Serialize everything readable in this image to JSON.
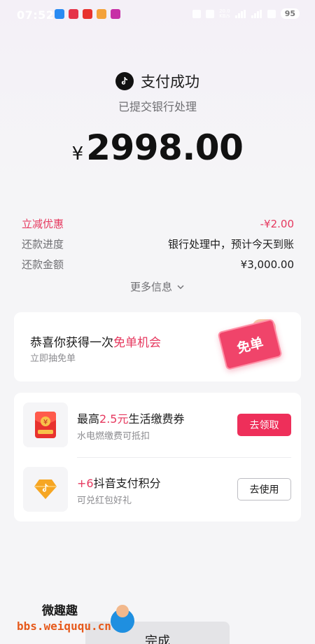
{
  "status_bar": {
    "time": "07:52",
    "net_speed_value": "20.0",
    "net_speed_unit": "KB/s",
    "battery": "95"
  },
  "header": {
    "title": "支付成功",
    "subtitle": "已提交银行处理",
    "currency_symbol": "¥",
    "amount": "2998.00"
  },
  "details": [
    {
      "label": "立减优惠",
      "value": "-¥2.00",
      "highlight": true
    },
    {
      "label": "还款进度",
      "value": "银行处理中，预计今天到账",
      "highlight": false
    },
    {
      "label": "还款金额",
      "value": "¥3,000.00",
      "highlight": false
    }
  ],
  "more_info_label": "更多信息",
  "promo": {
    "title_prefix": "恭喜你获得一次",
    "title_highlight": "免单机会",
    "subtitle": "立即抽免单",
    "badge_text": "免单"
  },
  "coupons": [
    {
      "title_prefix": "最高",
      "title_highlight": "2.5元",
      "title_suffix": "生活缴费券",
      "subtitle": "水电燃缴费可抵扣",
      "button": "去领取",
      "icon": "red-envelope-icon"
    },
    {
      "title_prefix": "",
      "title_highlight": "+6",
      "title_suffix": "抖音支付积分",
      "subtitle": "可兑红包好礼",
      "button": "去使用",
      "icon": "points-diamond-icon"
    }
  ],
  "done_button": "完成",
  "watermark": {
    "title": "微趣趣",
    "url": "bbs.weiququ.cn"
  },
  "colors": {
    "accent": "#ee2f5a",
    "highlight_text": "#e6395f",
    "background": "#f5f5f7"
  }
}
